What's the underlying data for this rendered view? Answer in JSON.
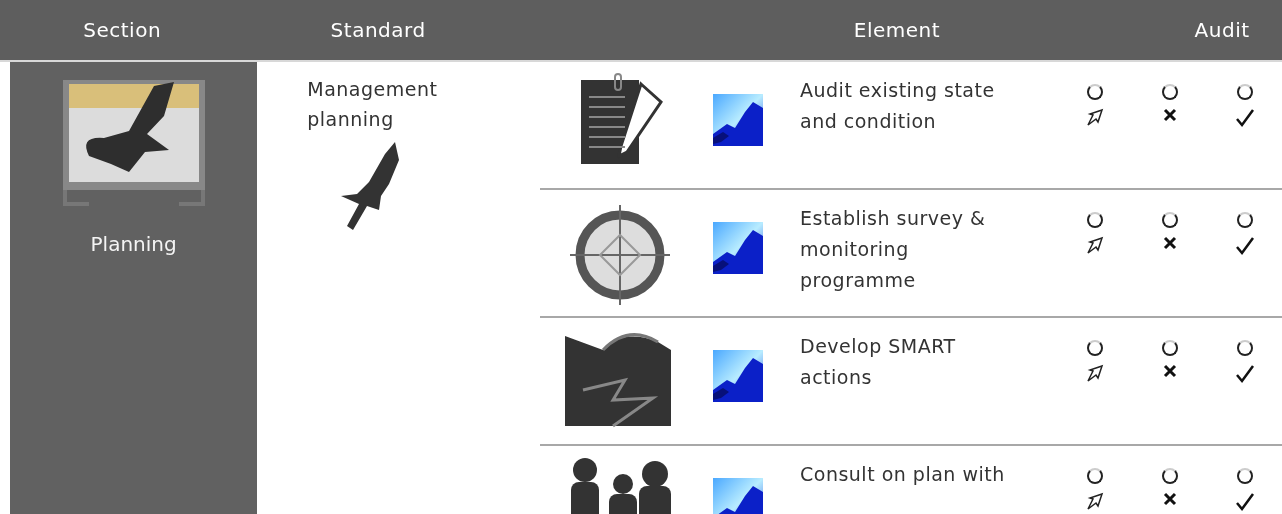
{
  "header": {
    "columns": [
      "Section",
      "Standard",
      "Element",
      "Audit"
    ]
  },
  "section": {
    "label": "Planning"
  },
  "standard": {
    "label": "Management planning"
  },
  "elements": [
    {
      "kind": "document",
      "text": "Audit existing state and condition",
      "audit": [
        {
          "selected": false
        },
        {
          "selected": false
        },
        {
          "selected": false
        }
      ]
    },
    {
      "kind": "target",
      "text": "Establish survey & monitoring programme",
      "audit": [
        {
          "selected": false
        },
        {
          "selected": false
        },
        {
          "selected": false
        }
      ]
    },
    {
      "kind": "landscape",
      "text": "Develop SMART actions",
      "audit": [
        {
          "selected": false
        },
        {
          "selected": false
        },
        {
          "selected": false
        }
      ]
    },
    {
      "kind": "people",
      "text": "Consult on plan with",
      "audit": [
        {
          "selected": false
        },
        {
          "selected": false
        },
        {
          "selected": false
        }
      ]
    }
  ]
}
